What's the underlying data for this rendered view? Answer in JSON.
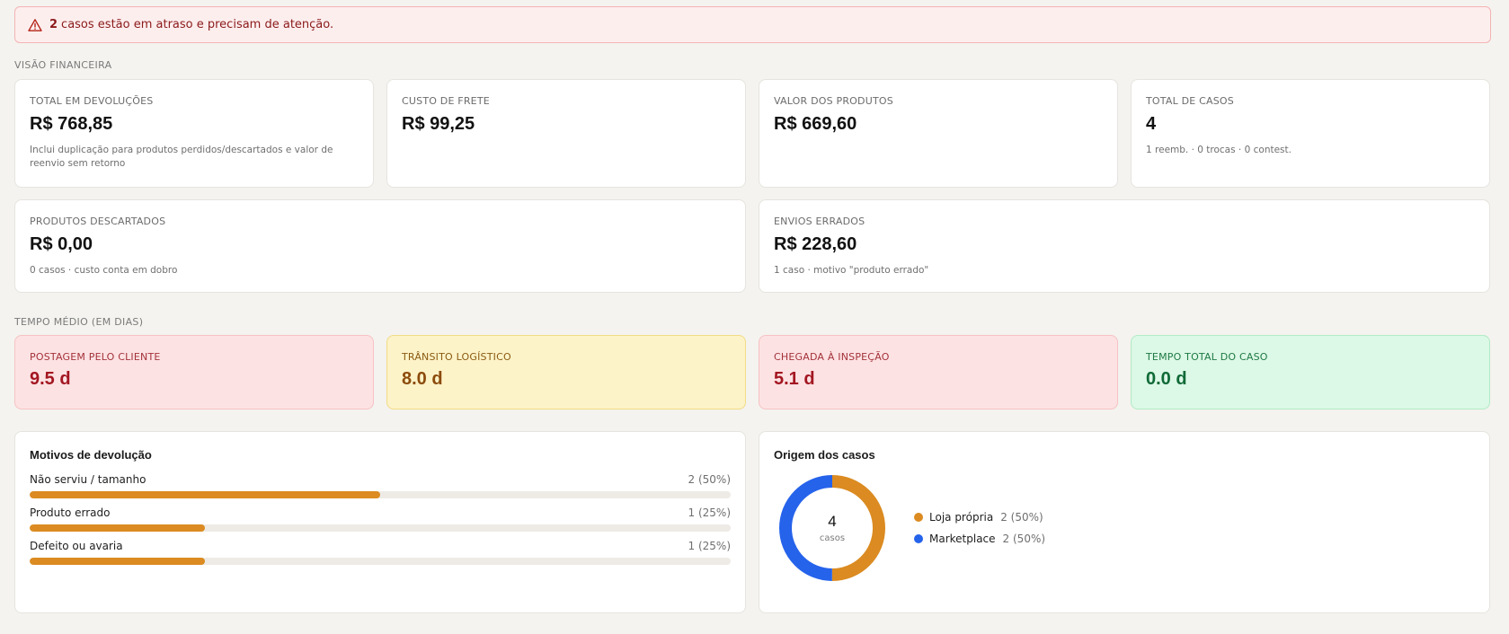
{
  "alert": {
    "icon": "warning-triangle-icon",
    "count": "2",
    "message": "casos estão em atraso e precisam de atenção."
  },
  "financial": {
    "section_title": "VISÃO FINANCEIRA",
    "cards": [
      {
        "label": "TOTAL EM DEVOLUÇÕES",
        "value": "R$ 768,85",
        "note": "Inclui duplicação para produtos perdidos/descartados e valor de reenvio sem retorno"
      },
      {
        "label": "CUSTO DE FRETE",
        "value": "R$ 99,25",
        "note": ""
      },
      {
        "label": "VALOR DOS PRODUTOS",
        "value": "R$ 669,60",
        "note": ""
      },
      {
        "label": "TOTAL DE CASOS",
        "value": "4",
        "note": "1 reemb. · 0 trocas · 0 contest."
      }
    ],
    "cards2": [
      {
        "label": "PRODUTOS DESCARTADOS",
        "value": "R$ 0,00",
        "note": "0 casos · custo conta em dobro"
      },
      {
        "label": "ENVIOS ERRADOS",
        "value": "R$ 228,60",
        "note": "1 caso · motivo \"produto errado\""
      }
    ]
  },
  "times": {
    "section_title": "TEMPO MÉDIO (EM DIAS)",
    "cards": [
      {
        "label": "POSTAGEM PELO CLIENTE",
        "value": "9.5 d",
        "tone": "red"
      },
      {
        "label": "TRÂNSITO LOGÍSTICO",
        "value": "8.0 d",
        "tone": "yellow"
      },
      {
        "label": "CHEGADA À INSPEÇÃO",
        "value": "5.1 d",
        "tone": "red"
      },
      {
        "label": "TEMPO TOTAL DO CASO",
        "value": "0.0 d",
        "tone": "green"
      }
    ]
  },
  "reasons": {
    "title": "Motivos de devolução",
    "items": [
      {
        "label": "Não serviu / tamanho",
        "count": "2 (50%)",
        "fraction": 0.5
      },
      {
        "label": "Produto errado",
        "count": "1 (25%)",
        "fraction": 0.25
      },
      {
        "label": "Defeito ou avaria",
        "count": "1 (25%)",
        "fraction": 0.25
      }
    ],
    "bar_color": "#db8b21"
  },
  "origin": {
    "title": "Origem dos casos",
    "total": "4",
    "total_label": "casos",
    "segments": [
      {
        "label": "Loja própria",
        "count": "2 (50%)",
        "value": 2,
        "color": "#db8b21"
      },
      {
        "label": "Marketplace",
        "count": "2 (50%)",
        "value": 2,
        "color": "#2563eb"
      }
    ]
  }
}
